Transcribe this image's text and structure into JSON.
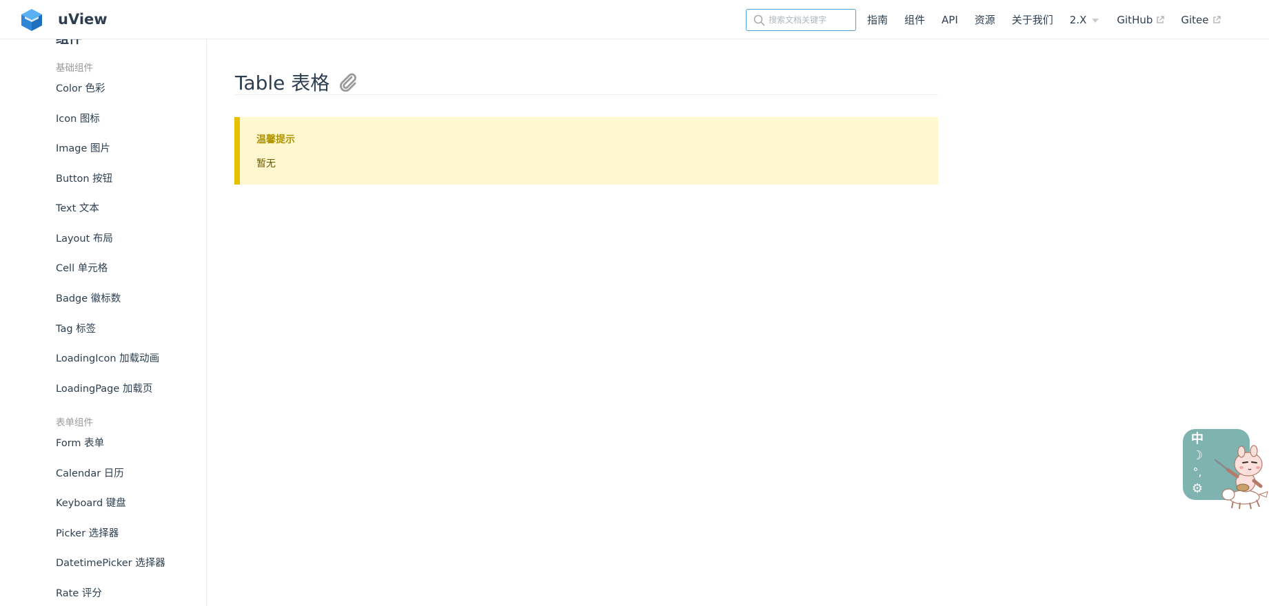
{
  "navbar": {
    "site_name": "uView",
    "search": {
      "placeholder": "搜索文档关键字",
      "value": ""
    },
    "links": [
      {
        "label": "指南"
      },
      {
        "label": "组件"
      },
      {
        "label": "API"
      },
      {
        "label": "资源"
      },
      {
        "label": "关于我们"
      },
      {
        "label": "2.X"
      },
      {
        "label": "GitHub"
      },
      {
        "label": "Gitee"
      }
    ]
  },
  "sidebar": {
    "partial_heading": "组件",
    "groups": [
      {
        "title": "基础组件",
        "items": [
          "Color 色彩",
          "Icon 图标",
          "Image 图片",
          "Button 按钮",
          "Text 文本",
          "Layout 布局",
          "Cell 单元格",
          "Badge 徽标数",
          "Tag 标签",
          "LoadingIcon 加载动画",
          "LoadingPage 加载页"
        ]
      },
      {
        "title": "表单组件",
        "items": [
          "Form 表单",
          "Calendar 日历",
          "Keyboard 键盘",
          "Picker 选择器",
          "DatetimePicker 选择器",
          "Rate 评分"
        ]
      }
    ]
  },
  "main": {
    "title": "Table 表格",
    "tip": {
      "title": "温馨提示",
      "text": "暂无"
    }
  },
  "widget": {
    "buttons": [
      "中",
      "☽",
      "°,",
      "⚙"
    ]
  },
  "colors": {
    "accent": "#4ea1d3",
    "tip_border": "#e7c000",
    "tip_bg": "#fff7d0",
    "widget_bg": "#7fb3b0"
  }
}
